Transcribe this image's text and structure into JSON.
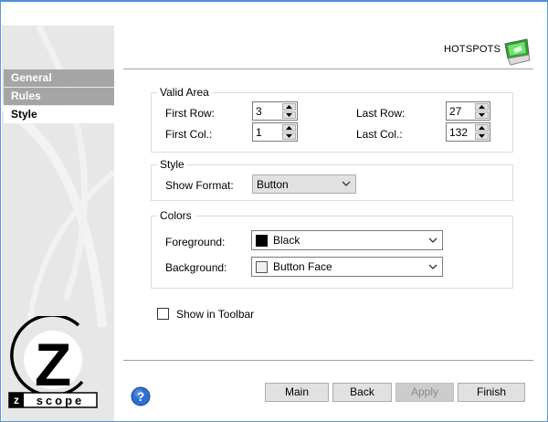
{
  "header": {
    "title": "HOTSPOTS",
    "icon": "hotspot-monitor-icon"
  },
  "sidebar": {
    "items": [
      {
        "label": "General",
        "selected": false
      },
      {
        "label": "Rules",
        "selected": false
      },
      {
        "label": "Style",
        "selected": true
      }
    ],
    "logo_text": "scope",
    "logo_letter": "Z"
  },
  "valid_area": {
    "title": "Valid Area",
    "first_row_label": "First Row:",
    "first_row_value": "3",
    "last_row_label": "Last Row:",
    "last_row_value": "27",
    "first_col_label": "First Col.:",
    "first_col_value": "1",
    "last_col_label": "Last Col.:",
    "last_col_value": "132"
  },
  "style": {
    "title": "Style",
    "show_format_label": "Show Format:",
    "show_format_value": "Button"
  },
  "colors": {
    "title": "Colors",
    "foreground_label": "Foreground:",
    "foreground_value": "Black",
    "foreground_swatch": "#000000",
    "background_label": "Background:",
    "background_value": "Button Face",
    "background_swatch": "#f0f0f0"
  },
  "toolbar_option": {
    "label": "Show in Toolbar",
    "checked": false
  },
  "buttons": {
    "main": "Main",
    "back": "Back",
    "apply": "Apply",
    "finish": "Finish"
  }
}
